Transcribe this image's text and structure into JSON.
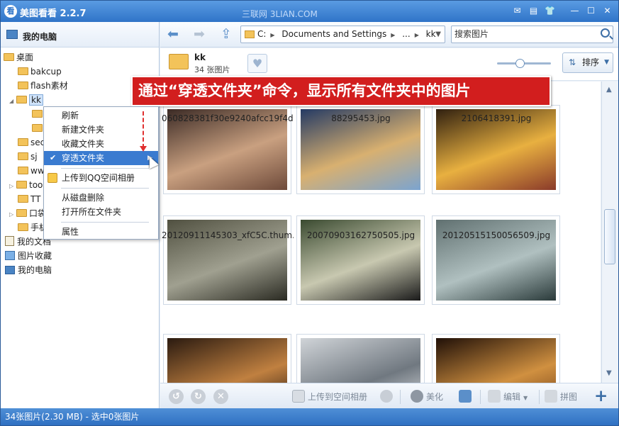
{
  "app": {
    "title": "美图看看 2.2.7",
    "icon_char": "看",
    "watermark": "三联网 3LIAN.COM"
  },
  "titlebar_buttons": [
    "message-icon",
    "menu-icon",
    "skin-icon",
    "minimize-icon",
    "maximize-icon",
    "close-icon"
  ],
  "sidebar": {
    "header": "我的电脑",
    "tree": [
      {
        "label": "桌面",
        "type": "folder"
      },
      {
        "label": "bakcup",
        "type": "folder"
      },
      {
        "label": "flash素材",
        "type": "folder"
      },
      {
        "label": "kk",
        "type": "folder",
        "selected": true
      },
      {
        "label": "",
        "type": "folder"
      },
      {
        "label": "",
        "type": "folder"
      },
      {
        "label": "sec",
        "type": "folder"
      },
      {
        "label": "sj",
        "type": "folder"
      },
      {
        "label": "www",
        "type": "folder"
      },
      {
        "label": "too",
        "type": "folder"
      },
      {
        "label": "TT",
        "type": "folder"
      },
      {
        "label": "口袋",
        "type": "folder"
      },
      {
        "label": "手机",
        "type": "folder"
      },
      {
        "label": "我的文档",
        "type": "doc"
      },
      {
        "label": "图片收藏",
        "type": "pic"
      },
      {
        "label": "我的电脑",
        "type": "pc"
      }
    ]
  },
  "context_menu": {
    "items": [
      {
        "label": "刷新"
      },
      {
        "label": "新建文件夹"
      },
      {
        "label": "收藏文件夹"
      },
      {
        "label": "穿透文件夹",
        "checked": true,
        "highlighted": true,
        "submenu": true
      },
      {
        "label": "上传到QQ空间相册",
        "icon": "qzone-icon"
      },
      {
        "label": "从磁盘删除"
      },
      {
        "label": "打开所在文件夹"
      },
      {
        "label": "属性"
      }
    ]
  },
  "toolbar": {
    "address": [
      "C:",
      "Documents and Settings",
      "...",
      "kk"
    ],
    "search_placeholder": "搜索图片"
  },
  "folder": {
    "name": "kk",
    "count": "34 张图片"
  },
  "zoom_level": 0.42,
  "sort_label": "排序",
  "banner": "通过“穿透文件夹”命令，显示所有文件夹中的图片",
  "thumbnails": [
    {
      "name": "060828381f30e9240afcc19f4d...",
      "colors": [
        "#3b2a25",
        "#c9a080",
        "#6e4a3a"
      ]
    },
    {
      "name": "88295453.jpg",
      "colors": [
        "#243a64",
        "#d8b070",
        "#7ba4d0"
      ]
    },
    {
      "name": "2106418391.jpg",
      "colors": [
        "#302010",
        "#e8b040",
        "#8a3a2a"
      ]
    },
    {
      "name": "20120911145303_xfC5C.thum...",
      "colors": [
        "#505040",
        "#a0a090",
        "#2a2a22"
      ]
    },
    {
      "name": "20070903162750505.jpg",
      "colors": [
        "#3a4a30",
        "#c8c8b0",
        "#1a1a1a"
      ]
    },
    {
      "name": "20120515150056509.jpg",
      "colors": [
        "#607070",
        "#b0c0c0",
        "#2a3a3a"
      ]
    },
    {
      "name": "",
      "colors": [
        "#2a1a10",
        "#c08040",
        "#100808"
      ]
    },
    {
      "name": "",
      "colors": [
        "#d0d4d8",
        "#707880",
        "#f0f2f4"
      ]
    },
    {
      "name": "",
      "colors": [
        "#201008",
        "#d09040",
        "#603010"
      ]
    }
  ],
  "bottombar": {
    "upload": "上传到空间相册",
    "beautify": "美化",
    "edit": "编辑",
    "collage": "拼图"
  },
  "status": "34张图片(2.30 MB) - 选中0张图片"
}
